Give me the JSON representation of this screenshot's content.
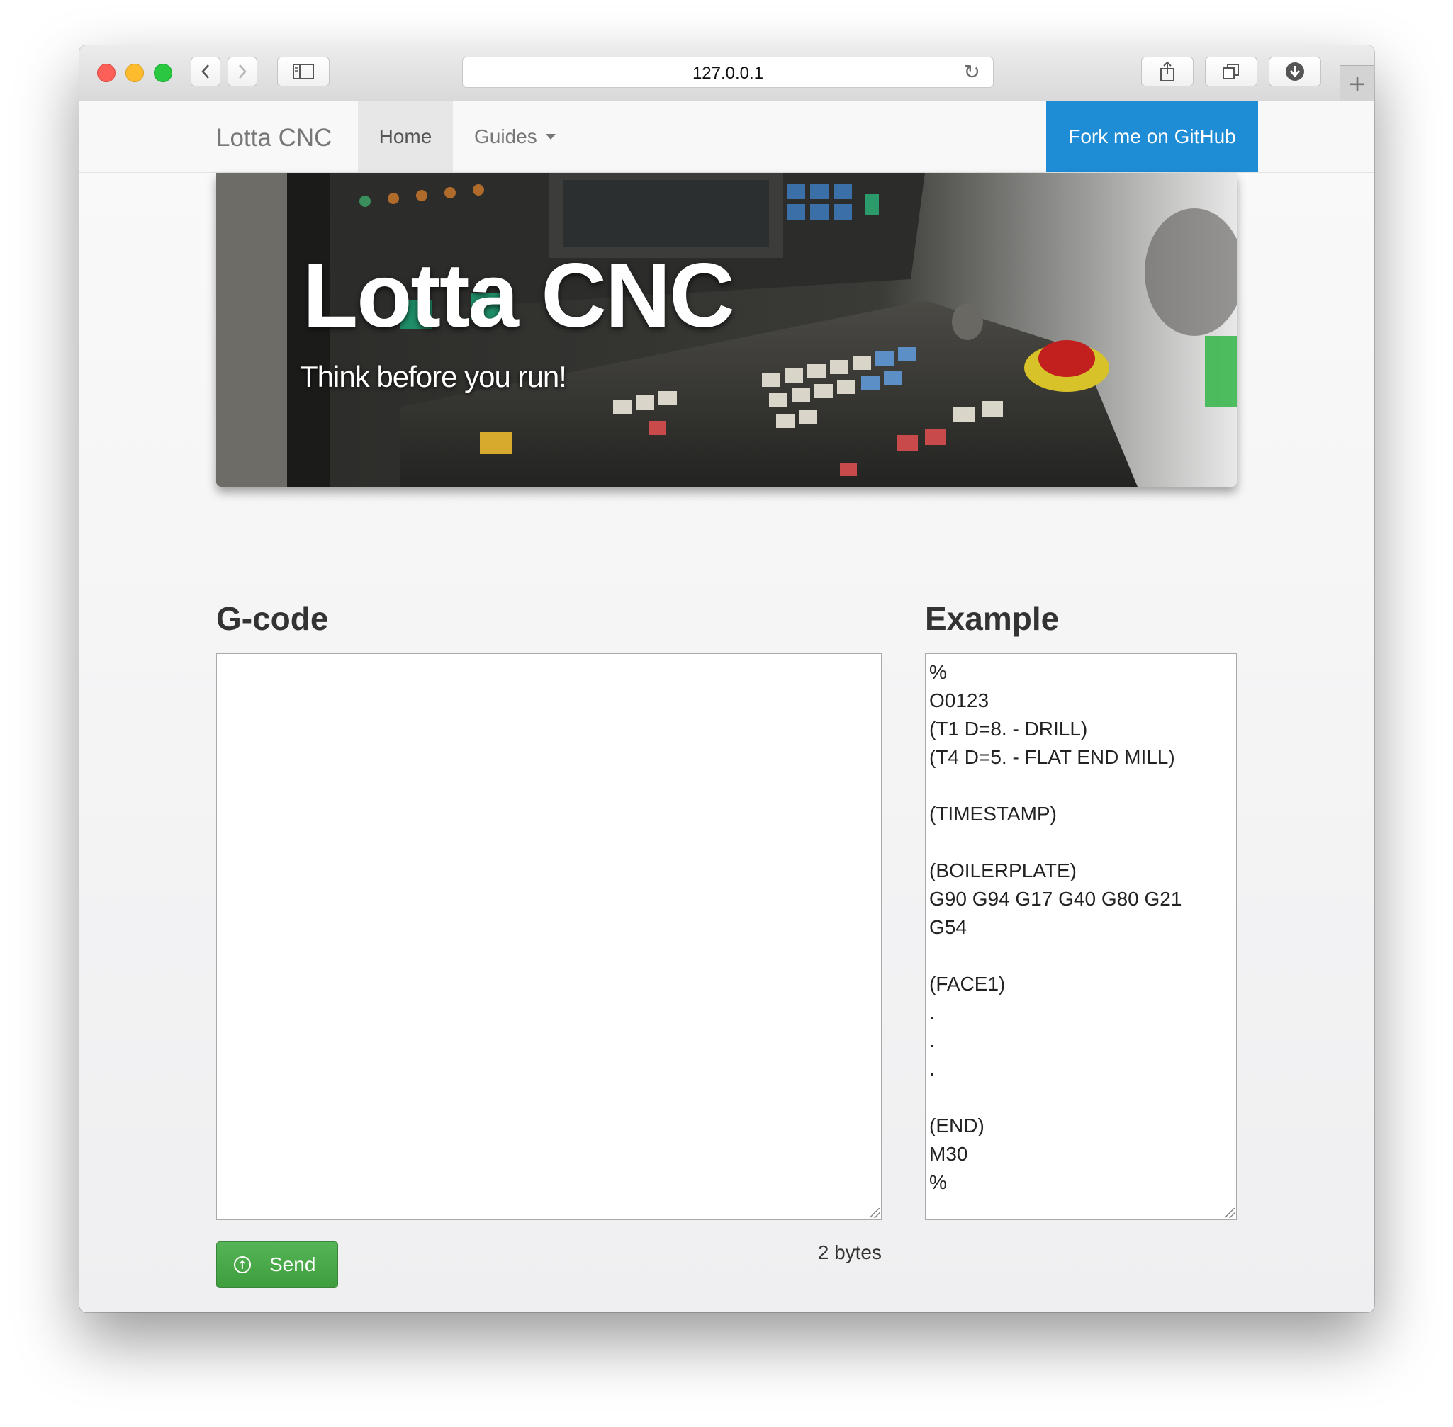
{
  "browser": {
    "url": "127.0.0.1",
    "icons": {
      "back": "chevron-left-icon",
      "forward": "chevron-right-icon",
      "sidebar": "sidebar-icon",
      "reload": "reload-icon",
      "share": "share-icon",
      "tabs": "tabs-icon",
      "downloads": "download-icon",
      "new_tab": "plus-icon"
    }
  },
  "navbar": {
    "brand": "Lotta CNC",
    "home": "Home",
    "guides": "Guides",
    "fork": "Fork me on GitHub",
    "fork_color": "#1f8dd6"
  },
  "hero": {
    "title": "Lotta CNC",
    "subtitle": "Think before you run!"
  },
  "gcode": {
    "heading": "G-code",
    "value": ""
  },
  "example": {
    "heading": "Example",
    "code": "%\nO0123\n(T1 D=8. - DRILL)\n(T4 D=5. - FLAT END MILL)\n\n(TIMESTAMP)\n\n(BOILERPLATE)\nG90 G94 G17 G40 G80 G21\nG54\n\n(FACE1)\n.\n.\n.\n\n(END)\nM30\n%"
  },
  "actions": {
    "send_label": "Send",
    "send_color": "#4cae4c",
    "byte_count": "2 bytes"
  }
}
